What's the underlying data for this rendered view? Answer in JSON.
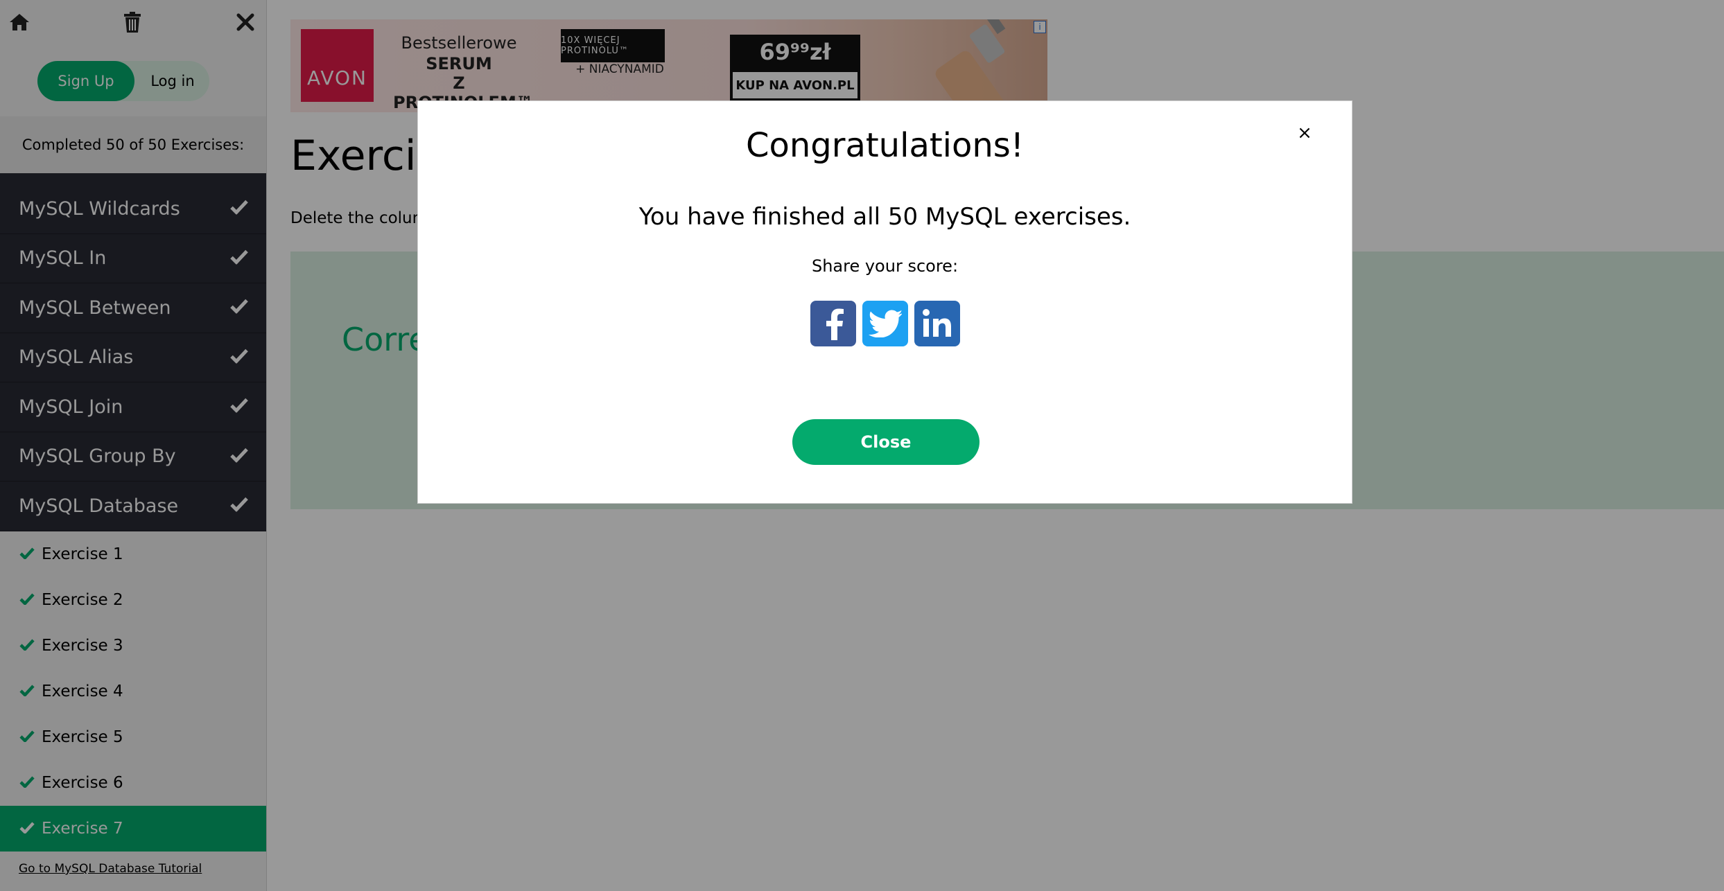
{
  "sidebar": {
    "toolbar": {
      "home_icon": "home-icon",
      "trash_icon": "trash-icon",
      "close_icon": "close-icon"
    },
    "auth": {
      "signup_label": "Sign Up",
      "login_label": "Log in"
    },
    "progress_text": "Completed 50 of 50 Exercises:",
    "categories": [
      {
        "label": "MySQL Wildcards"
      },
      {
        "label": "MySQL In"
      },
      {
        "label": "MySQL Between"
      },
      {
        "label": "MySQL Alias"
      },
      {
        "label": "MySQL Join"
      },
      {
        "label": "MySQL Group By"
      },
      {
        "label": "MySQL Database"
      }
    ],
    "exercises": [
      {
        "label": "Exercise 1"
      },
      {
        "label": "Exercise 2"
      },
      {
        "label": "Exercise 3"
      },
      {
        "label": "Exercise 4"
      },
      {
        "label": "Exercise 5"
      },
      {
        "label": "Exercise 6"
      },
      {
        "label": "Exercise 7"
      }
    ],
    "active_exercise": "Exercise 7",
    "tutorial_link": "Go to MySQL Database Tutorial"
  },
  "main": {
    "ad": {
      "brand": "AVON",
      "headline": "Bestsellerowe",
      "headline_bold": "SERUM\nZ PROTINOLEM™",
      "badge": "10X WIĘCEJ PROTINOLU™",
      "sub": "+ NIACYNAMID",
      "price": "69⁹⁹zł",
      "cta": "KUP NA AVON.PL",
      "info": "i"
    },
    "title": "Exercis",
    "description": "Delete the colun",
    "result_text": "Corre"
  },
  "modal": {
    "title": "Congratulations!",
    "message": "You have finished all 50 MySQL exercises.",
    "share_label": "Share your score:",
    "close_x": "×",
    "close_button": "Close",
    "social": [
      "facebook-icon",
      "twitter-icon",
      "linkedin-icon"
    ]
  },
  "colors": {
    "accent": "#04aa6d",
    "sidebar_dark": "#282a35",
    "success_bg": "#d9eee1",
    "facebook": "#3b5998",
    "twitter": "#1da1f2",
    "linkedin": "#2867b2"
  }
}
